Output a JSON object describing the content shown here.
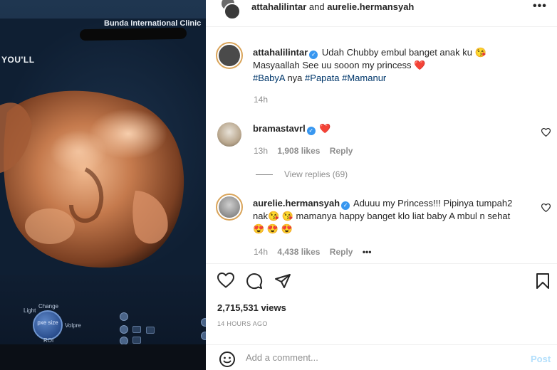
{
  "media": {
    "clinic_name": "Bunda International Clinic",
    "overlay_text": "YOU'LL",
    "controls": {
      "knob_top": "Change",
      "knob_left": "Light",
      "knob_right": "Volpre",
      "knob_bottom": "ROI",
      "knob_center": "pxe size"
    }
  },
  "header": {
    "user1": "attahalilintar",
    "joiner": "and",
    "user2": "aurelie.hermansyah",
    "more_icon": "more-horizontal-icon"
  },
  "caption": {
    "username": "attahalilintar",
    "text_line1": "Udah Chubby embul banget anak ku 😘",
    "text_line2": "Masyaallah See uu sooon my princess ❤️",
    "hashtag1": "#BabyA",
    "hashtag_mid": "nya",
    "hashtag2": "#Papata",
    "hashtag3": "#Mamanur",
    "time": "14h"
  },
  "comments": [
    {
      "username": "bramastavrl",
      "text": "❤️",
      "time": "13h",
      "likes": "1,908 likes",
      "reply": "Reply",
      "view_replies": "View replies (69)"
    },
    {
      "username": "aurelie.hermansyah",
      "text_line1": "Aduuu my Princess!!! Pipinya tumpah2",
      "text_line2": "nak😘 😘 mamanya happy banget klo liat baby A mbul n sehat",
      "text_line3": "😍 😍 😍",
      "time": "14h",
      "likes": "4,438 likes",
      "reply": "Reply",
      "more": "•••"
    }
  ],
  "stats": {
    "views": "2,715,531 views",
    "posted": "14 HOURS AGO"
  },
  "comment_box": {
    "placeholder": "Add a comment...",
    "post_label": "Post"
  },
  "colors": {
    "link": "#00376b",
    "muted": "#8e8e8e",
    "verified": "#3897f0",
    "post_disabled": "#b2dffc",
    "heart": "#ed4956"
  }
}
